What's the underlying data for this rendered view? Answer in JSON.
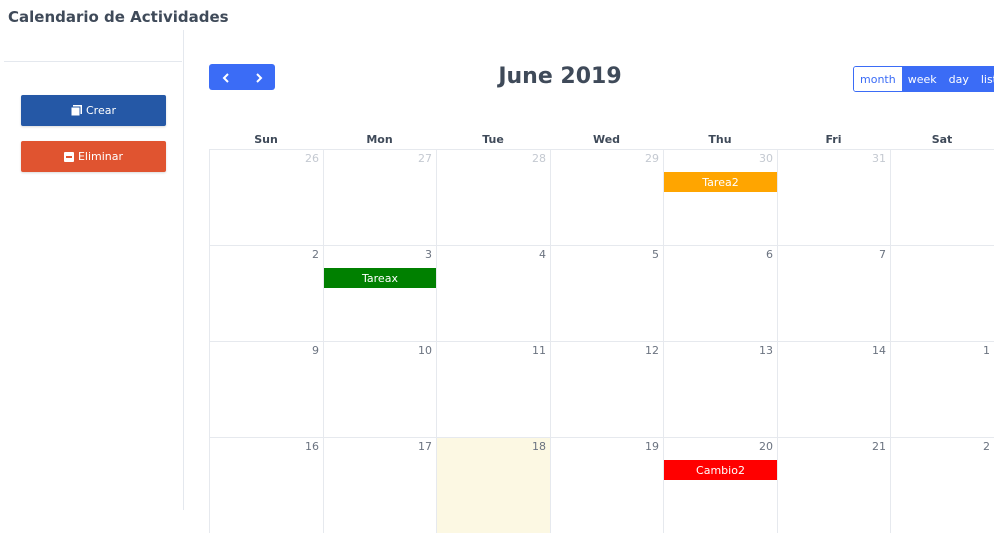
{
  "app": {
    "title": "Calendario de Actividades"
  },
  "sidebar": {
    "crear_label": "Crear",
    "eliminar_label": "Eliminar",
    "crear_color": "#2558a6",
    "eliminar_color": "#e05430"
  },
  "calendar": {
    "title": "June 2019",
    "nav": {
      "prev_icon": "chevron-left-icon",
      "next_icon": "chevron-right-icon"
    },
    "views": [
      "month",
      "week",
      "day",
      "list"
    ],
    "active_view": "month",
    "days_of_week": [
      "Sun",
      "Mon",
      "Tue",
      "Wed",
      "Thu",
      "Fri",
      "Sat"
    ],
    "weeks": [
      [
        "26",
        "27",
        "28",
        "29",
        "30",
        "31",
        ""
      ],
      [
        "2",
        "3",
        "4",
        "5",
        "6",
        "7",
        ""
      ],
      [
        "9",
        "10",
        "11",
        "12",
        "13",
        "14",
        "1"
      ],
      [
        "16",
        "17",
        "18",
        "19",
        "20",
        "21",
        "2"
      ]
    ],
    "today_label": "18",
    "events": {
      "tarea2": {
        "title": "Tarea2",
        "color": "#ffa500"
      },
      "tareax": {
        "title": "Tareax",
        "color": "#008000"
      },
      "cambio2": {
        "title": "Cambio2",
        "color": "#ff0000"
      }
    }
  }
}
